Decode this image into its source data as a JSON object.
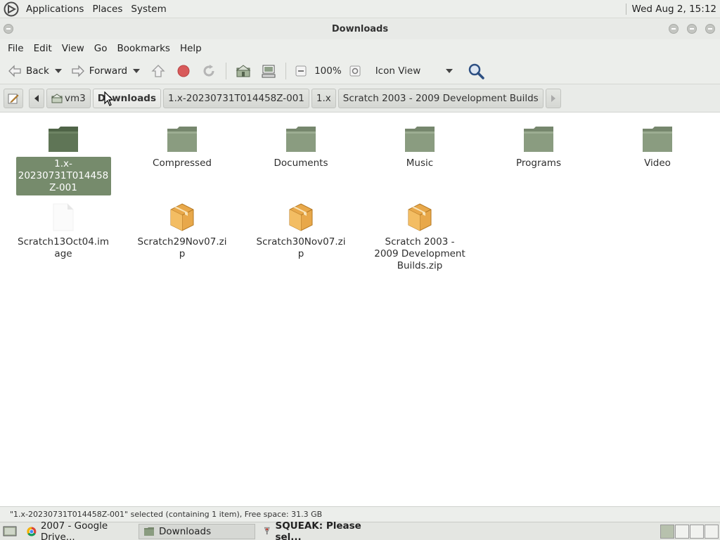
{
  "top_panel": {
    "menus": [
      "Applications",
      "Places",
      "System"
    ],
    "clock": "Wed Aug  2, 15:12"
  },
  "window": {
    "title": "Downloads"
  },
  "menubar": [
    "File",
    "Edit",
    "View",
    "Go",
    "Bookmarks",
    "Help"
  ],
  "toolbar": {
    "back_label": "Back",
    "forward_label": "Forward",
    "zoom": "100%",
    "view_mode": "Icon View"
  },
  "location": {
    "crumbs": [
      "vm3",
      "Downloads",
      "1.x-20230731T014458Z-001",
      "1.x",
      "Scratch 2003 - 2009 Development Builds"
    ],
    "active": "Downloads"
  },
  "files": [
    {
      "name": "1.x-20230731T014458Z-001",
      "type": "folder",
      "selected": true
    },
    {
      "name": "Compressed",
      "type": "folder"
    },
    {
      "name": "Documents",
      "type": "folder"
    },
    {
      "name": "Music",
      "type": "folder"
    },
    {
      "name": "Programs",
      "type": "folder"
    },
    {
      "name": "Video",
      "type": "folder"
    },
    {
      "name": "Scratch13Oct04.image",
      "type": "file"
    },
    {
      "name": "Scratch29Nov07.zip",
      "type": "archive"
    },
    {
      "name": "Scratch30Nov07.zip",
      "type": "archive"
    },
    {
      "name": "Scratch 2003 - 2009 Development Builds.zip",
      "type": "archive"
    }
  ],
  "status": "\"1.x-20230731T014458Z-001\" selected (containing 1 item), Free space: 31.3 GB",
  "taskbar": {
    "tasks": [
      {
        "label": "2007 - Google Drive...",
        "icon": "chrome-icon"
      },
      {
        "label": "Downloads",
        "icon": "folder-icon",
        "active": true
      },
      {
        "label": "SQUEAK: Please sel...",
        "icon": "squeak-icon"
      }
    ]
  },
  "colors": {
    "selection": "#768b6c",
    "folder": "#8a9c80",
    "folder_selected": "#5f7556",
    "archive": "#e8a84a"
  }
}
